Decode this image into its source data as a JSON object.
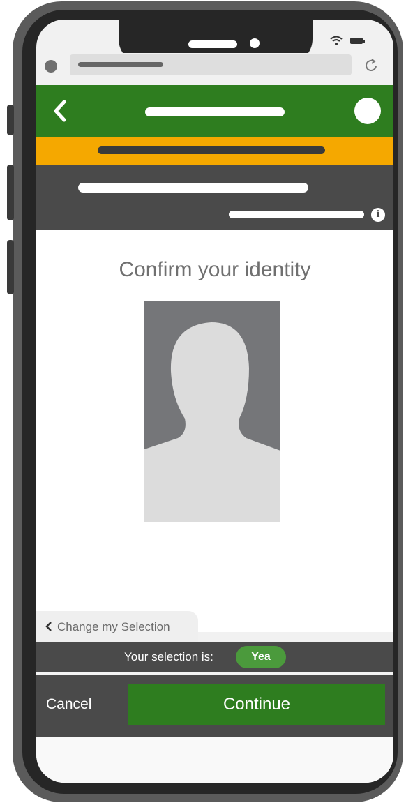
{
  "content": {
    "title": "Confirm your identity",
    "change_selection_label": "Change my Selection"
  },
  "selection": {
    "label": "Your selection is:",
    "value": "Yea"
  },
  "footer": {
    "cancel_label": "Cancel",
    "continue_label": "Continue"
  },
  "info_icon_glyph": "i",
  "icons": [
    "wifi-icon",
    "battery-icon",
    "reload-icon",
    "back-icon",
    "info-icon",
    "chevron-left-icon",
    "avatar-silhouette"
  ],
  "colors": {
    "primary_green": "#2e7d1f",
    "banner_yellow": "#f5a800",
    "dark_gray": "#4a4a4a",
    "pill_green": "#4b9a3c"
  }
}
